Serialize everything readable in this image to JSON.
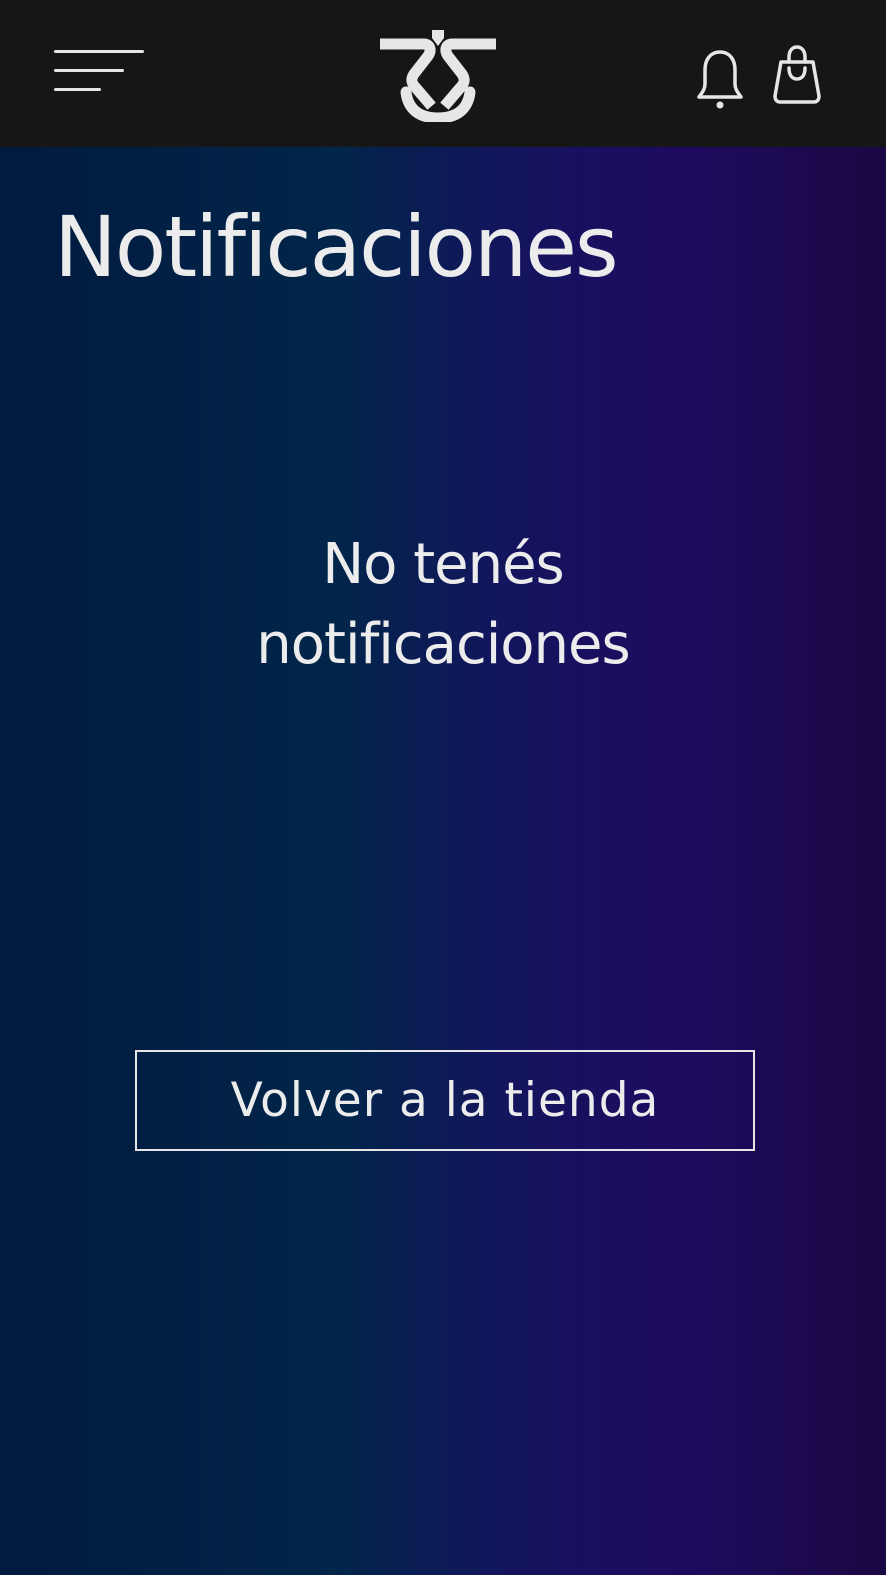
{
  "header": {
    "menu_icon": "hamburger-menu-icon",
    "logo": "rs-logo",
    "notifications_icon": "bell-icon",
    "cart_icon": "shopping-bag-icon"
  },
  "main": {
    "title": "Notificaciones",
    "empty_line1": "No tenés",
    "empty_line2": "notificaciones",
    "back_button_label": "Volver a la tienda"
  },
  "colors": {
    "header_bg": "#161616",
    "gradient_start": "#011a3e",
    "gradient_mid": "#14145e",
    "gradient_end": "#1a0843",
    "text": "#ececec"
  }
}
